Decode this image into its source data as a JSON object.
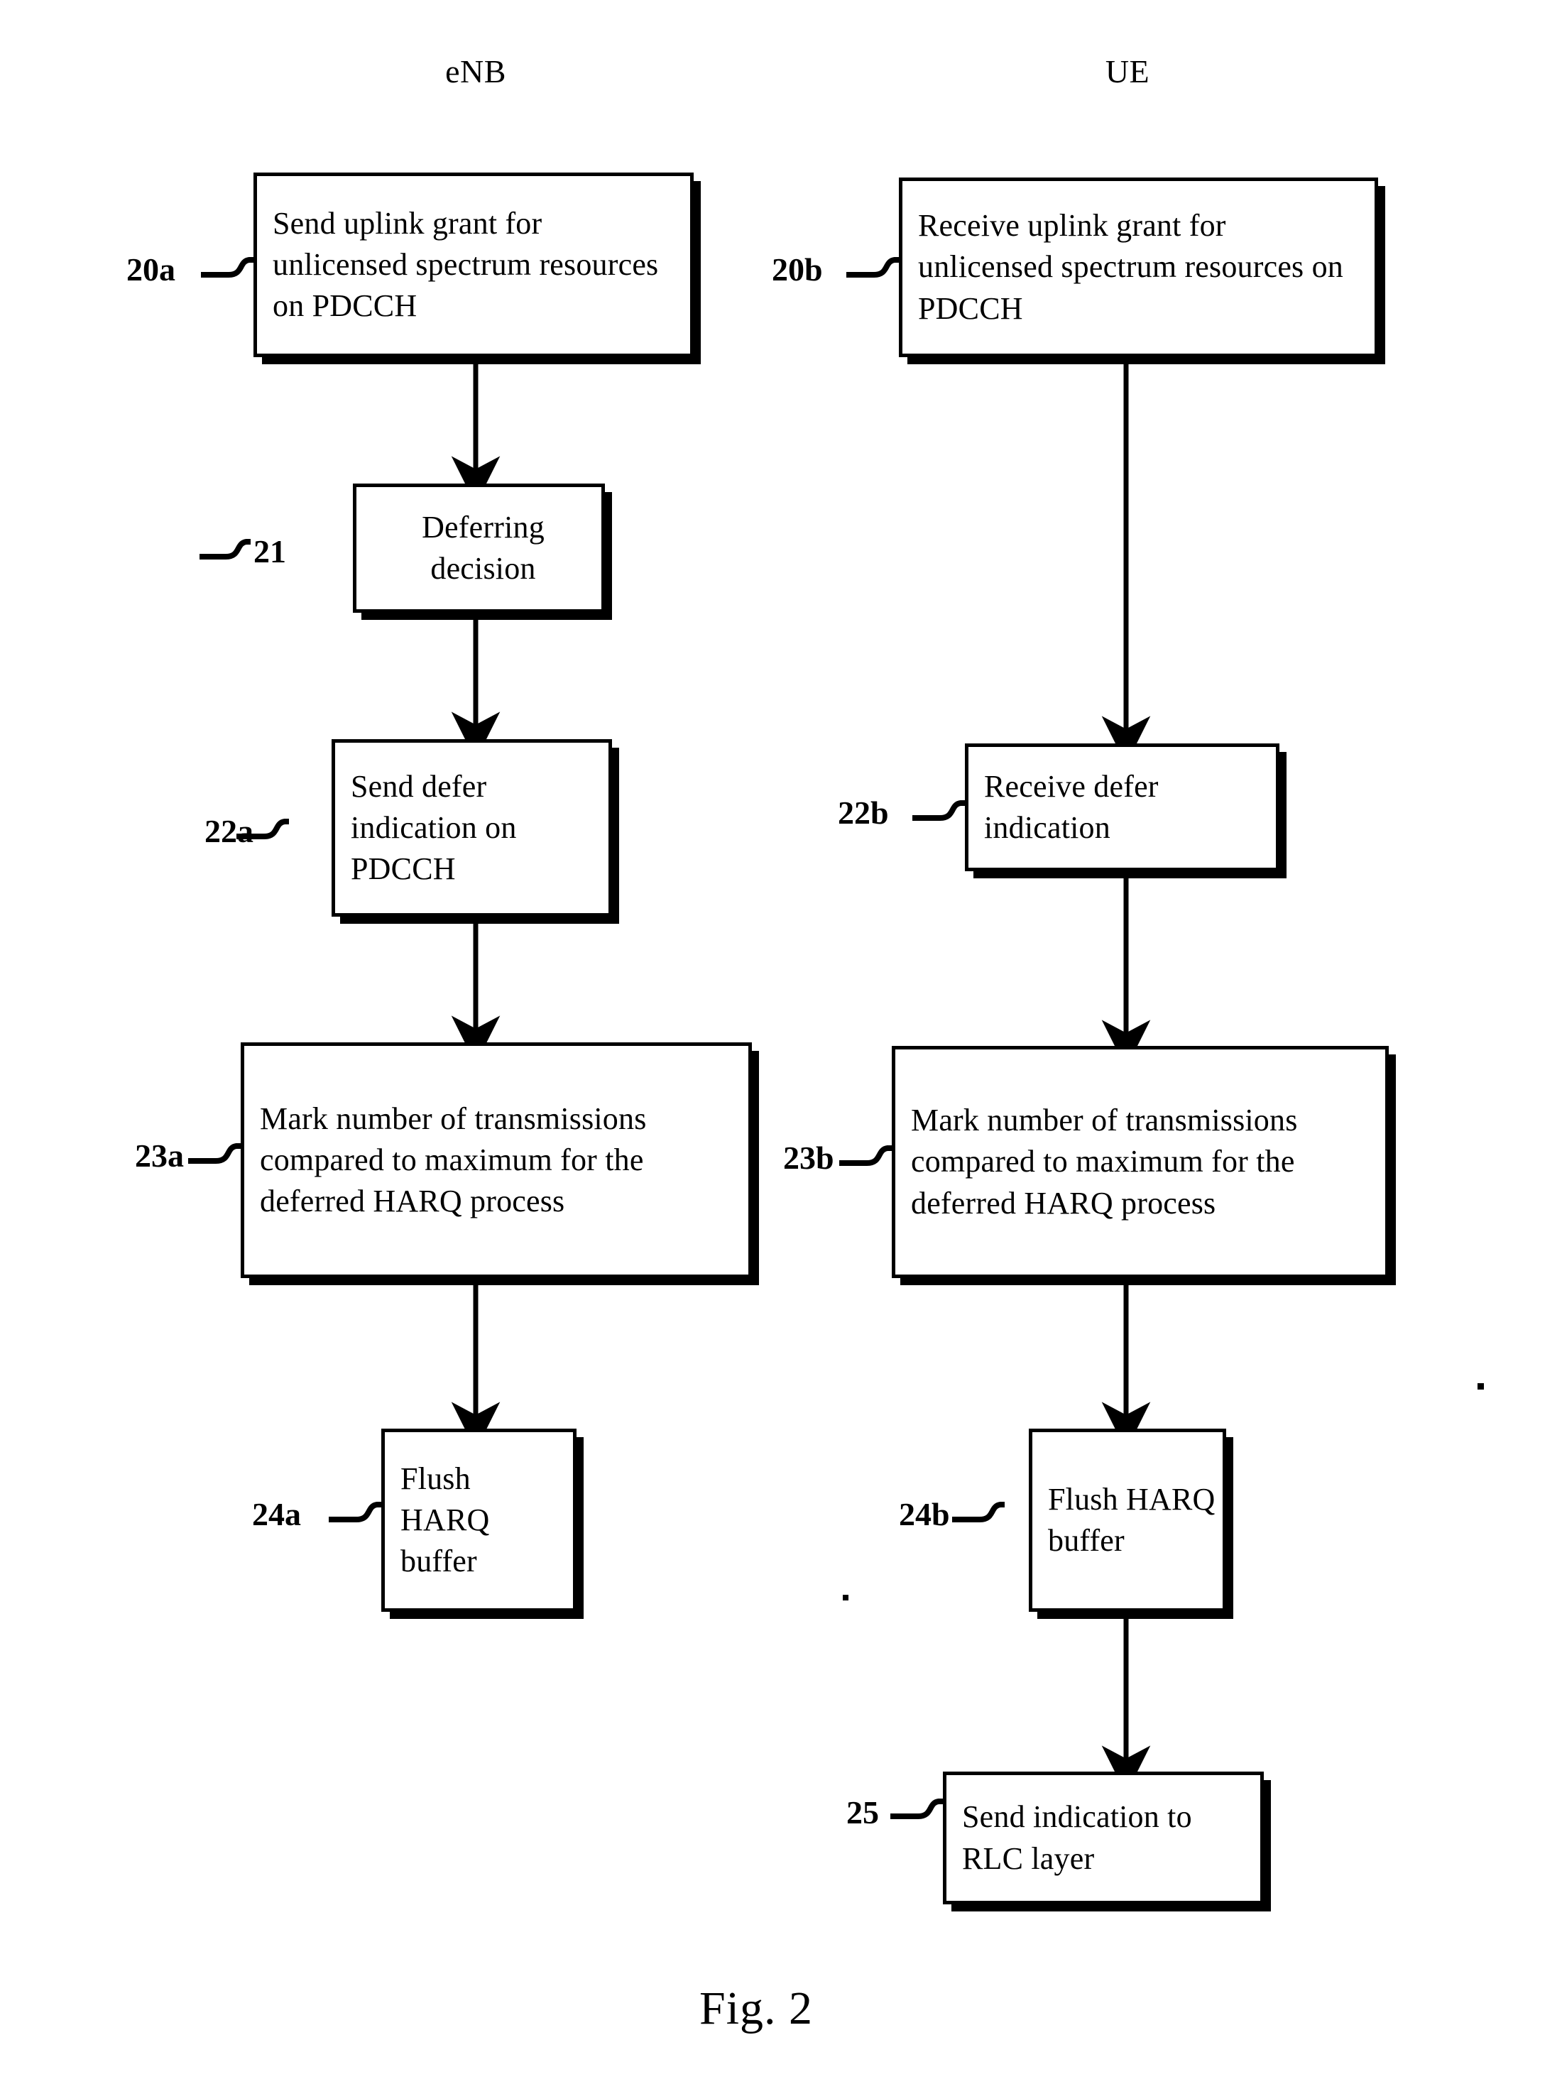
{
  "figure": {
    "caption": "Fig. 2",
    "columns": [
      {
        "id": "enb",
        "label": "eNB"
      },
      {
        "id": "ue",
        "label": "UE"
      }
    ]
  },
  "enb_column": {
    "header": "eNB",
    "steps": [
      {
        "ref": "20a",
        "text": "Send uplink grant for unlicensed spectrum resources on PDCCH"
      },
      {
        "ref": "21",
        "text": "Deferring decision"
      },
      {
        "ref": "22a",
        "text": "Send defer indication on PDCCH"
      },
      {
        "ref": "23a",
        "text": "Mark number of transmissions compared to maximum for the deferred HARQ process"
      },
      {
        "ref": "24a",
        "text": "Flush HARQ buffer"
      }
    ]
  },
  "ue_column": {
    "header": "UE",
    "steps": [
      {
        "ref": "20b",
        "text": "Receive uplink grant for unlicensed spectrum resources on PDCCH"
      },
      {
        "ref": "22b",
        "text": "Receive defer indication"
      },
      {
        "ref": "23b",
        "text": "Mark number of transmissions compared to maximum for the deferred HARQ process"
      },
      {
        "ref": "24b",
        "text": "Flush HARQ buffer"
      },
      {
        "ref": "25",
        "text": "Send indication to RLC layer"
      }
    ]
  },
  "colors": {
    "ink": "#000000",
    "paper": "#ffffff"
  }
}
